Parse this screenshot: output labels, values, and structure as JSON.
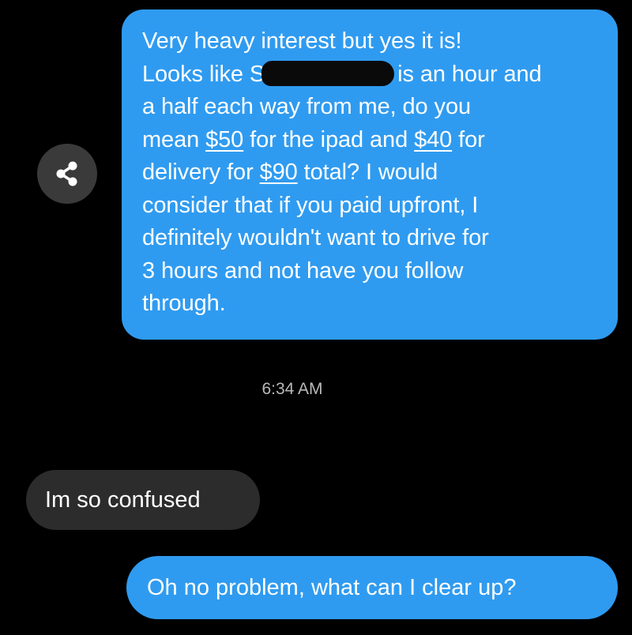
{
  "messages": [
    {
      "direction": "outgoing",
      "lines": [
        [
          "Very heavy interest but yes it is!"
        ],
        [
          "Looks like S",
          "is an hour and"
        ],
        [
          "a half each way from me,  do you"
        ],
        [
          "mean ",
          "$50",
          " for the ipad and ",
          "$40",
          " for"
        ],
        [
          "delivery for ",
          "$90",
          " total? I would"
        ],
        [
          "consider that if you paid upfront, I"
        ],
        [
          "definitely wouldn't want to drive for"
        ],
        [
          "3 hours and not have you follow"
        ],
        [
          "through."
        ]
      ]
    },
    {
      "direction": "incoming",
      "text": "Im so confused"
    },
    {
      "direction": "outgoing",
      "text": "Oh no problem, what can I clear up?"
    }
  ],
  "timestamp": "6:34 AM",
  "share_button": {
    "icon": "share-icon"
  },
  "colors": {
    "background": "#000000",
    "outgoing_bubble": "#2f9bf0",
    "incoming_bubble": "#2c2c2c",
    "share_button": "#3a3a3a",
    "timestamp": "#b9b9b9"
  }
}
